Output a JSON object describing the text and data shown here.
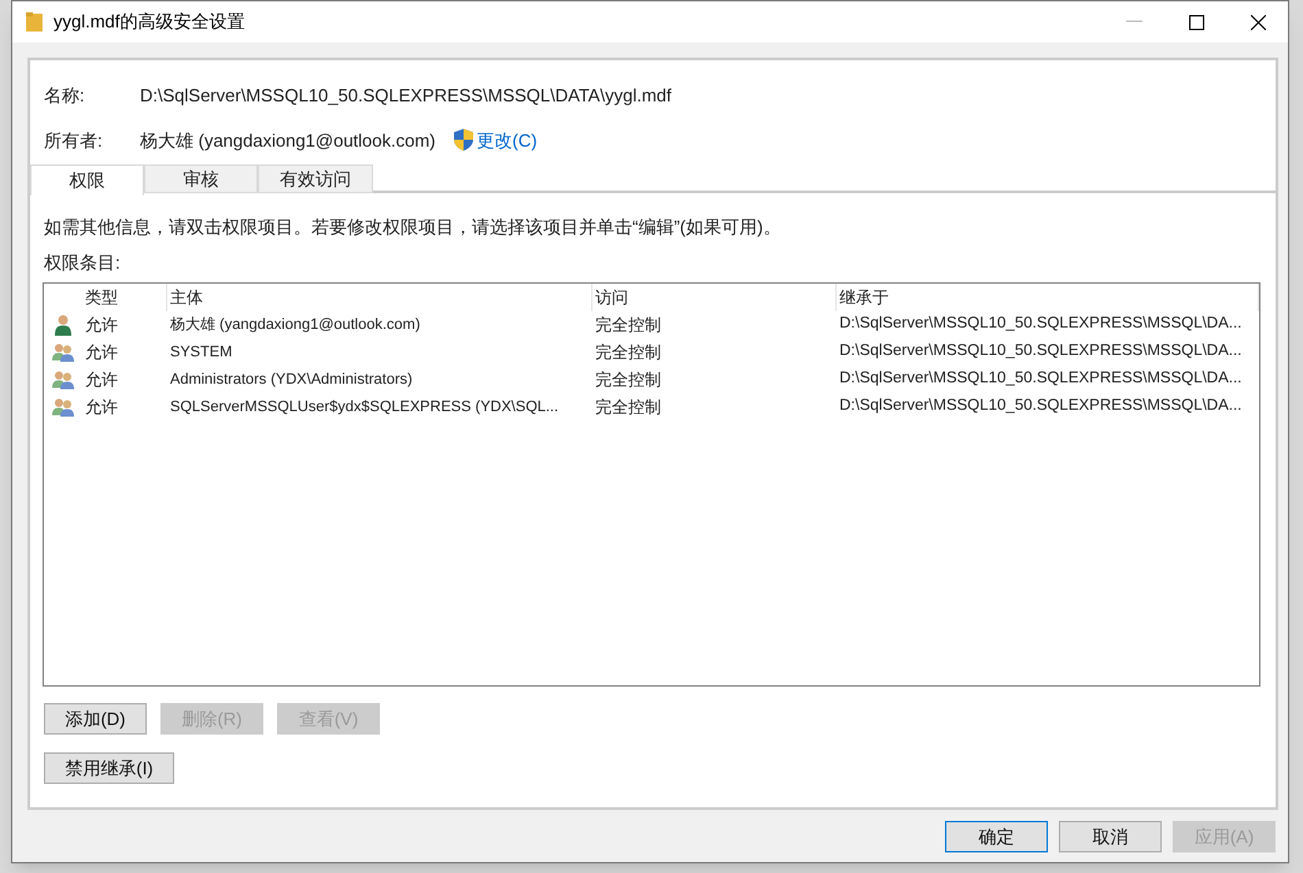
{
  "window": {
    "title": "yygl.mdf的高级安全设置"
  },
  "name": {
    "label": "名称:",
    "value": "D:\\SqlServer\\MSSQL10_50.SQLEXPRESS\\MSSQL\\DATA\\yygl.mdf"
  },
  "owner": {
    "label": "所有者:",
    "value": "杨大雄 (yangdaxiong1@outlook.com)",
    "change_link": "更改(C)"
  },
  "tabs": [
    {
      "label": "权限",
      "selected": true
    },
    {
      "label": "审核",
      "selected": false
    },
    {
      "label": "有效访问",
      "selected": false
    }
  ],
  "info_text": "如需其他信息，请双击权限项目。若要修改权限项目，请选择该项目并单击“编辑”(如果可用)。",
  "entries_label": "权限条目:",
  "table": {
    "columns": [
      "类型",
      "主体",
      "访问",
      "继承于"
    ],
    "rows": [
      {
        "kind": "user",
        "type": "允许",
        "principal": "杨大雄 (yangdaxiong1@outlook.com)",
        "access": "完全控制",
        "inherited_from": "D:\\SqlServer\\MSSQL10_50.SQLEXPRESS\\MSSQL\\DA..."
      },
      {
        "kind": "group",
        "type": "允许",
        "principal": "SYSTEM",
        "access": "完全控制",
        "inherited_from": "D:\\SqlServer\\MSSQL10_50.SQLEXPRESS\\MSSQL\\DA..."
      },
      {
        "kind": "group",
        "type": "允许",
        "principal": "Administrators (YDX\\Administrators)",
        "access": "完全控制",
        "inherited_from": "D:\\SqlServer\\MSSQL10_50.SQLEXPRESS\\MSSQL\\DA..."
      },
      {
        "kind": "group",
        "type": "允许",
        "principal": "SQLServerMSSQLUser$ydx$SQLEXPRESS (YDX\\SQL...",
        "access": "完全控制",
        "inherited_from": "D:\\SqlServer\\MSSQL10_50.SQLEXPRESS\\MSSQL\\DA..."
      }
    ]
  },
  "entry_buttons": [
    {
      "label": "添加(D)",
      "disabled": false
    },
    {
      "label": "删除(R)",
      "disabled": true
    },
    {
      "label": "查看(V)",
      "disabled": true
    }
  ],
  "inheritance_button": {
    "label": "禁用继承(I)",
    "disabled": false
  },
  "dialog_buttons": [
    {
      "label": "确定",
      "disabled": false,
      "default": true
    },
    {
      "label": "取消",
      "disabled": false,
      "default": false
    },
    {
      "label": "应用(A)",
      "disabled": true,
      "default": false
    }
  ]
}
